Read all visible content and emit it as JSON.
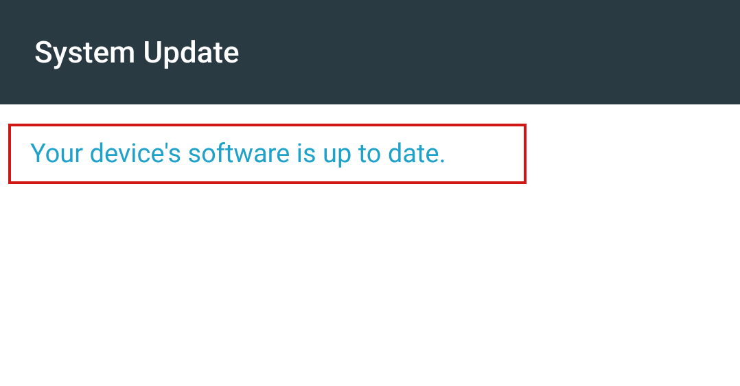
{
  "header": {
    "title": "System Update"
  },
  "status": {
    "message": "Your device's software is up to date."
  },
  "colors": {
    "headerBg": "#2a3a42",
    "statusText": "#1fa2c9",
    "highlightBorder": "#d11616"
  }
}
